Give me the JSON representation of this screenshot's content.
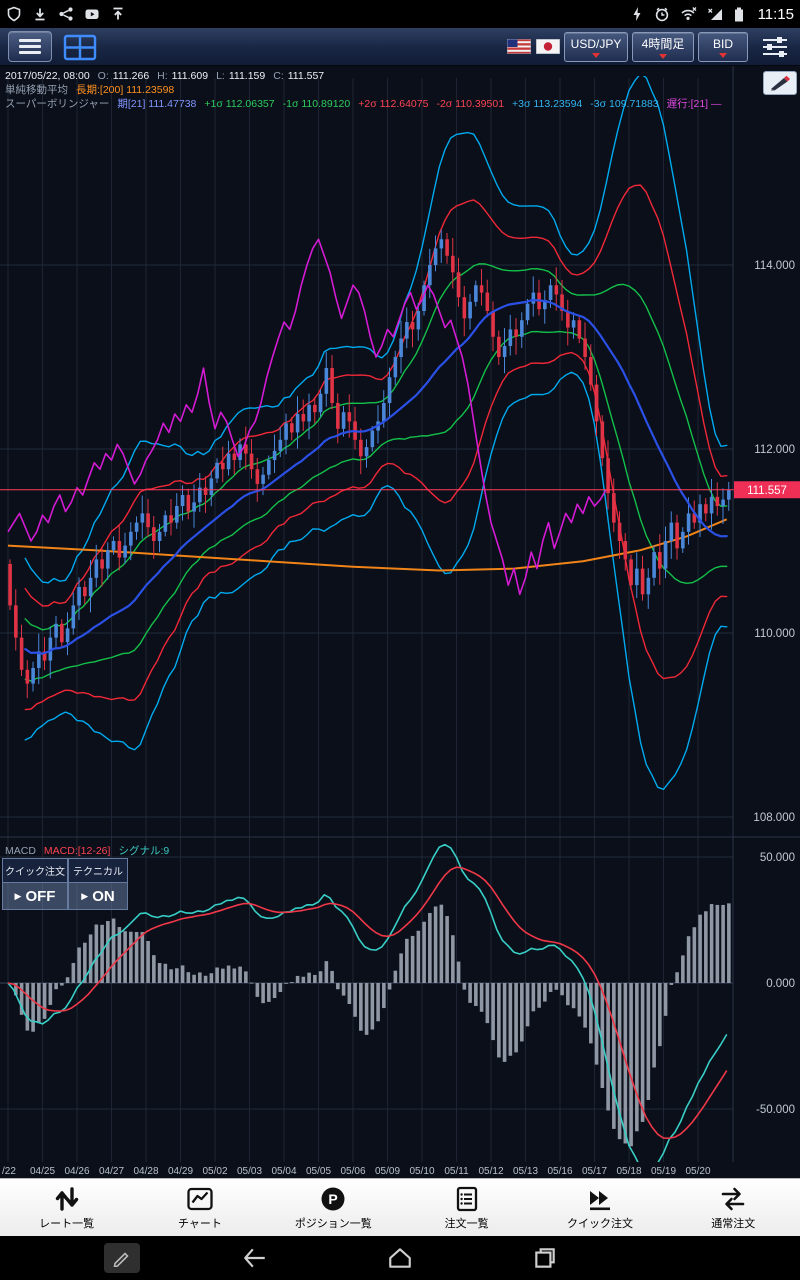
{
  "status_bar": {
    "time": "11:15",
    "left_icons": [
      "shield-icon",
      "download-icon",
      "share-icon",
      "play-icon",
      "upload-icon"
    ],
    "right_icons": [
      "power-icon",
      "alarm-icon",
      "wifi-x-icon",
      "signal-x-icon",
      "battery-icon"
    ]
  },
  "toolbar": {
    "pair": "USD/JPY",
    "timeframe": "4時間足",
    "price_side": "BID",
    "flags": [
      "US",
      "JP"
    ]
  },
  "info": {
    "datetime": "2017/05/22, 08:00",
    "o_label": "O:",
    "o": "111.266",
    "h_label": "H:",
    "h": "111.609",
    "l_label": "L:",
    "l": "111.159",
    "c_label": "C:",
    "c": "111.557"
  },
  "indicators": {
    "sma_row": {
      "name": "単純移動平均",
      "long": "長期:[200] 111.23598"
    },
    "boll_row": {
      "name": "スーパーボリンジャー",
      "center": "期[21] 111.47738",
      "s1p": "+1σ 112.06357",
      "s1m": "-1σ 110.89120",
      "s2p": "+2σ 112.64075",
      "s2m": "-2σ 110.39501",
      "s3p": "+3σ 113.23594",
      "s3m": "-3σ 109.71883",
      "lag": "遅行:[21] ―"
    },
    "macd_row": {
      "name": "MACD",
      "macd": "MACD:[12-26]",
      "signal": "シグナル:9"
    }
  },
  "overlay_buttons": {
    "quick_order": "クイック注文",
    "technical": "テクニカル",
    "off": "OFF",
    "on": "ON",
    "state_arrow": "▶"
  },
  "chart_data": {
    "type": "candlestick+macd",
    "colors": {
      "up": "#4b87d9",
      "down": "#e03345",
      "center": "#2b50e6",
      "sigma1": "#14c04a",
      "sigma2": "#f02838",
      "sigma3": "#00aaf0",
      "chikou": "#d41bd4",
      "sma200": "#f08418",
      "macd_line": "#38cfc7",
      "signal_line": "#f03848",
      "hist": "#8e97a3",
      "price_line": "#ff3f5f",
      "badge_bg": "#ef2f55"
    },
    "x_labels": [
      "/22",
      "04/25",
      "04/26",
      "04/27",
      "04/28",
      "04/29",
      "05/02",
      "05/03",
      "05/04",
      "05/05",
      "05/06",
      "05/09",
      "05/10",
      "05/11",
      "05/12",
      "05/13",
      "05/16",
      "05/17",
      "05/18",
      "05/19",
      "05/20"
    ],
    "main": {
      "ylim": [
        107.8,
        115.2
      ],
      "gridlines": [
        114,
        112,
        110,
        108
      ],
      "grid_labels": [
        "114.000",
        "112.000",
        "110.000",
        "108.000"
      ],
      "current_price": 111.557,
      "current_price_label": "111.557",
      "bollinger_period": 21,
      "chikou_shift": 21,
      "first_open": 110.75,
      "sma200_anchors": [
        [
          0,
          110.95
        ],
        [
          15,
          110.9
        ],
        [
          30,
          110.84
        ],
        [
          45,
          110.78
        ],
        [
          60,
          110.72
        ],
        [
          75,
          110.68
        ],
        [
          88,
          110.7
        ],
        [
          100,
          110.78
        ],
        [
          110,
          110.9
        ],
        [
          118,
          111.05
        ],
        [
          125,
          111.236
        ]
      ],
      "closes": [
        110.3,
        109.95,
        109.6,
        109.45,
        109.62,
        109.8,
        109.7,
        109.95,
        110.1,
        109.9,
        110.05,
        110.3,
        110.5,
        110.4,
        110.6,
        110.8,
        110.7,
        110.9,
        111.0,
        110.82,
        110.95,
        111.1,
        111.2,
        111.3,
        111.15,
        111.0,
        111.1,
        111.28,
        111.2,
        111.38,
        111.5,
        111.32,
        111.42,
        111.58,
        111.5,
        111.68,
        111.85,
        111.78,
        111.95,
        111.88,
        112.05,
        111.95,
        111.78,
        111.62,
        111.72,
        111.88,
        111.98,
        112.1,
        112.28,
        112.18,
        112.38,
        112.3,
        112.48,
        112.4,
        112.6,
        112.88,
        112.5,
        112.22,
        112.4,
        112.3,
        112.1,
        111.92,
        112.02,
        112.2,
        112.3,
        112.5,
        112.78,
        113.0,
        113.2,
        113.38,
        113.3,
        113.5,
        113.78,
        114.0,
        114.18,
        114.28,
        114.1,
        113.92,
        113.65,
        113.42,
        113.6,
        113.78,
        113.7,
        113.5,
        113.22,
        113.0,
        113.12,
        113.3,
        113.22,
        113.4,
        113.58,
        113.7,
        113.52,
        113.62,
        113.78,
        113.68,
        113.5,
        113.32,
        113.4,
        113.2,
        113.0,
        112.7,
        112.3,
        111.9,
        111.52,
        111.2,
        111.0,
        110.8,
        110.52,
        110.7,
        110.42,
        110.6,
        110.88,
        110.7,
        111.0,
        111.2,
        110.92,
        111.1,
        111.3,
        111.2,
        111.4,
        111.3,
        111.48,
        111.38,
        111.45,
        111.557
      ]
    },
    "macd": {
      "gridlines": [
        50,
        0,
        -50
      ],
      "grid_labels": [
        "50.000",
        "0.000",
        "-50.000"
      ],
      "fast": 12,
      "slow": 26,
      "signal": 9
    }
  },
  "bottom_nav": {
    "p_letter": "P",
    "items": [
      {
        "label": "レート一覧",
        "icon": "rates-icon"
      },
      {
        "label": "チャート",
        "icon": "chart-icon"
      },
      {
        "label": "ポジション一覧",
        "icon": "positions-icon"
      },
      {
        "label": "注文一覧",
        "icon": "orders-icon"
      },
      {
        "label": "クイック注文",
        "icon": "quick-order-icon"
      },
      {
        "label": "通常注文",
        "icon": "normal-order-icon"
      }
    ]
  },
  "android_nav": {
    "icons": [
      "handwriting-icon",
      "back-icon",
      "home-icon",
      "recents-icon"
    ]
  }
}
